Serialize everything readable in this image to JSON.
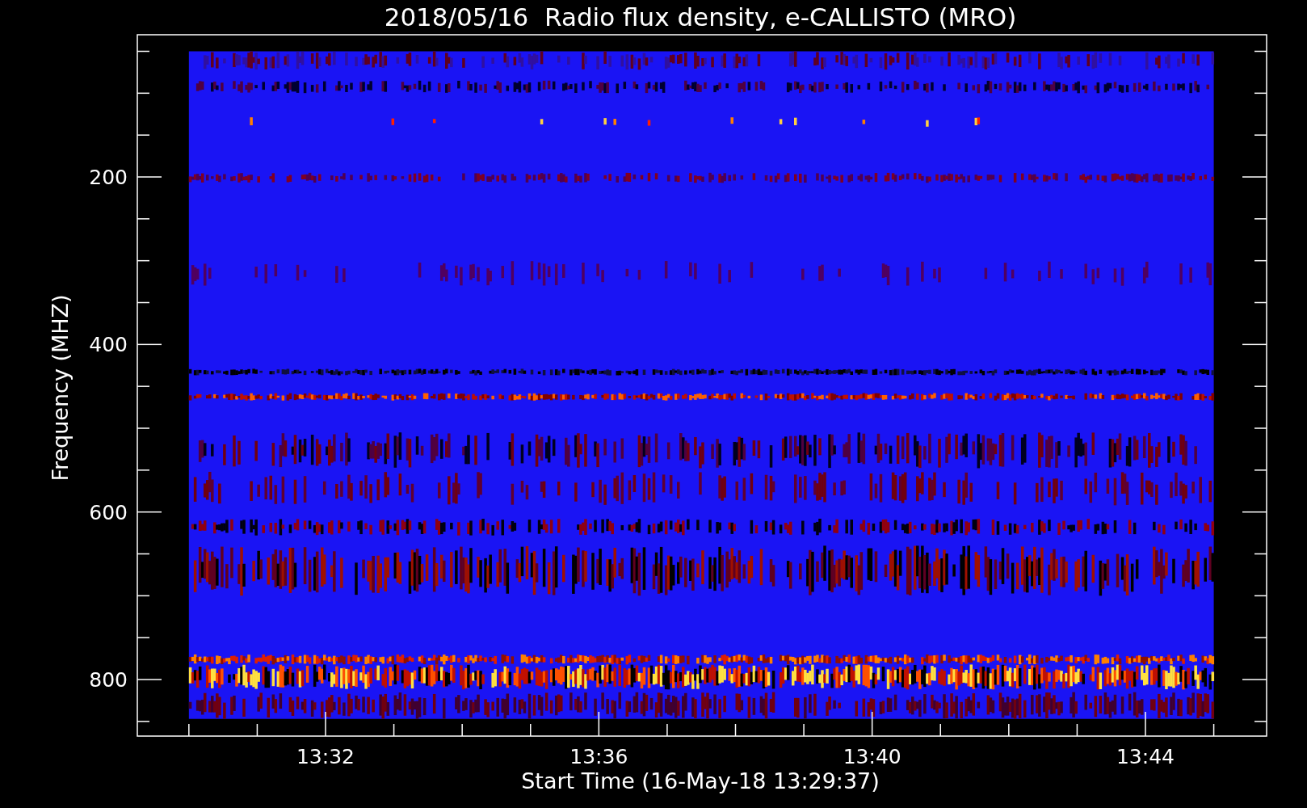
{
  "plot": {
    "title": "2018/05/16  Radio flux density, e-CALLISTO (MRO)",
    "x_axis": {
      "label": "Start Time (16-May-18 13:29:37)",
      "ticks": [
        "13:32",
        "13:36",
        "13:40",
        "13:44"
      ]
    },
    "y_axis": {
      "label": "Frequency (MHZ)",
      "ticks": [
        "200",
        "400",
        "600",
        "800"
      ]
    }
  }
}
